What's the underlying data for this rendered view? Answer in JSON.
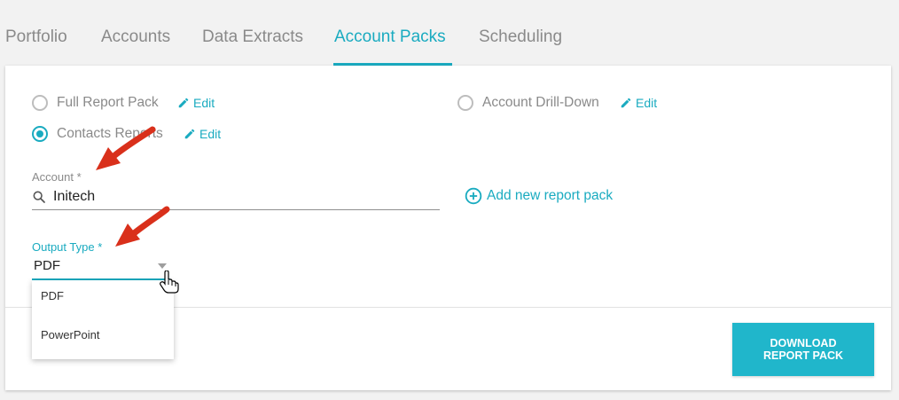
{
  "tabs": [
    {
      "label": "Portfolio"
    },
    {
      "label": "Accounts"
    },
    {
      "label": "Data Extracts"
    },
    {
      "label": "Account Packs"
    },
    {
      "label": "Scheduling"
    }
  ],
  "active_tab": "Account Packs",
  "report_options": {
    "full_report_pack": {
      "label": "Full Report Pack",
      "edit": "Edit",
      "checked": false
    },
    "account_drill_down": {
      "label": "Account Drill-Down",
      "edit": "Edit",
      "checked": false
    },
    "contacts_reports": {
      "label": "Contacts Reports",
      "edit": "Edit",
      "checked": true
    }
  },
  "account": {
    "label": "Account *",
    "value": "Initech",
    "icon": "search-icon"
  },
  "add_new": {
    "label": "Add new report pack",
    "icon": "plus-circle-icon"
  },
  "output_type": {
    "label": "Output Type *",
    "value": "PDF",
    "options": [
      "PDF",
      "PowerPoint"
    ]
  },
  "download_button": {
    "line1": "DOWNLOAD",
    "line2": "REPORT PACK"
  },
  "colors": {
    "accent": "#1aabc0",
    "button": "#20b6cb",
    "annotation_arrow": "#d9301b"
  }
}
